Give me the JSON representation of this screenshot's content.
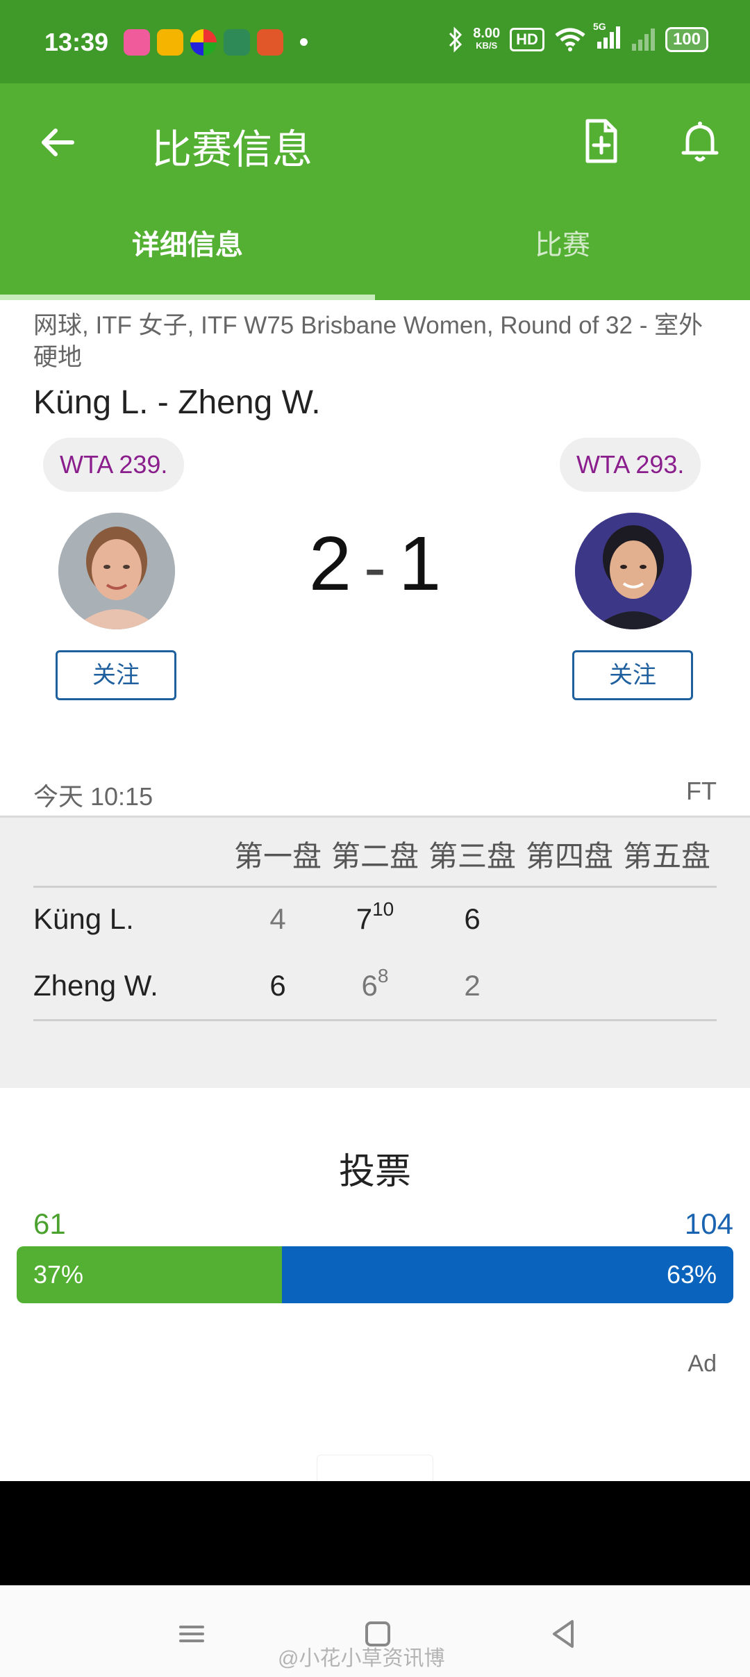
{
  "status_bar": {
    "time": "13:39",
    "net_speed_value": "8.00",
    "net_speed_unit": "KB/S",
    "hd_label": "HD",
    "network_label": "5G",
    "battery": "100"
  },
  "app_bar": {
    "title": "比赛信息"
  },
  "tabs": [
    {
      "label": "详细信息",
      "active": true
    },
    {
      "label": "比赛",
      "active": false
    }
  ],
  "match": {
    "info": "网球, ITF 女子, ITF W75 Brisbane Women, Round of 32 - 室外硬地",
    "title": "Küng L. - Zheng W.",
    "home": {
      "rank": "WTA 239.",
      "follow_label": "关注"
    },
    "away": {
      "rank": "WTA 293.",
      "follow_label": "关注"
    },
    "score_home": "2",
    "score_separator": "-",
    "score_away": "1",
    "time": "今天 10:15",
    "status": "FT"
  },
  "score_table": {
    "set_headers": [
      "第一盘",
      "第二盘",
      "第三盘",
      "第四盘",
      "第五盘"
    ],
    "rows": [
      {
        "player": "Küng L.",
        "sets": [
          {
            "games": "4",
            "tiebreak": ""
          },
          {
            "games": "7",
            "tiebreak": "10"
          },
          {
            "games": "6",
            "tiebreak": ""
          }
        ]
      },
      {
        "player": "Zheng W.",
        "sets": [
          {
            "games": "6",
            "tiebreak": ""
          },
          {
            "games": "6",
            "tiebreak": "8"
          },
          {
            "games": "2",
            "tiebreak": ""
          }
        ]
      }
    ]
  },
  "vote": {
    "title": "投票",
    "home_count": "61",
    "away_count": "104",
    "home_percent": "37%",
    "away_percent": "63%",
    "home_fraction": 0.37,
    "home_color": "#54b033",
    "away_color": "#0a63bd"
  },
  "ad": {
    "label": "Ad"
  },
  "watermark": "@小花小草资讯博",
  "colors": {
    "status_bar": "#3f9a2a",
    "app_bar": "#54b033",
    "rank_text": "#8a1e8c",
    "follow_border": "#1e5f9e"
  }
}
